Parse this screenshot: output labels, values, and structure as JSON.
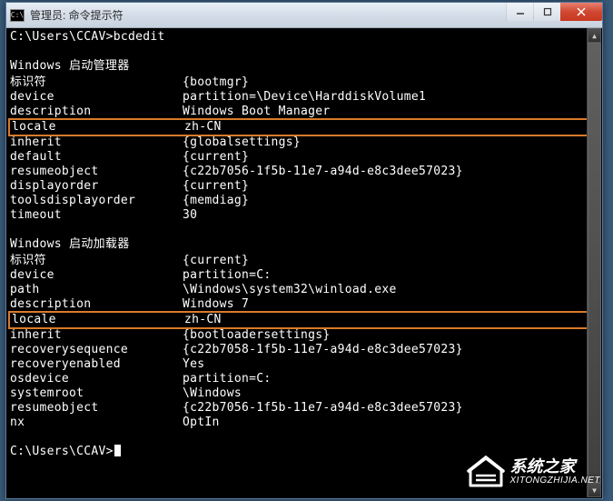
{
  "titlebar": {
    "icon_label": "C:\\",
    "text": "管理员: 命令提示符"
  },
  "controls": {
    "minimize": "—",
    "maximize": "□",
    "close": "×"
  },
  "terminal": {
    "prompt1": "C:\\Users\\CCAV>bcdedit",
    "section1_title": "Windows 启动管理器",
    "section1_divider": "--------------------",
    "section1_rows": [
      {
        "k": "标识符",
        "v": "{bootmgr}"
      },
      {
        "k": "device",
        "v": "partition=\\Device\\HarddiskVolume1"
      },
      {
        "k": "description",
        "v": "Windows Boot Manager"
      }
    ],
    "section1_highlight": {
      "k": "locale",
      "v": "zh-CN"
    },
    "section1_rows2": [
      {
        "k": "inherit",
        "v": "{globalsettings}"
      },
      {
        "k": "default",
        "v": "{current}"
      },
      {
        "k": "resumeobject",
        "v": "{c22b7056-1f5b-11e7-a94d-e8c3dee57023}"
      },
      {
        "k": "displayorder",
        "v": "{current}"
      },
      {
        "k": "toolsdisplayorder",
        "v": "{memdiag}"
      },
      {
        "k": "timeout",
        "v": "30"
      }
    ],
    "section2_title": "Windows 启动加载器",
    "section2_divider": "-------------------",
    "section2_rows": [
      {
        "k": "标识符",
        "v": "{current}"
      },
      {
        "k": "device",
        "v": "partition=C:"
      },
      {
        "k": "path",
        "v": "\\Windows\\system32\\winload.exe"
      },
      {
        "k": "description",
        "v": "Windows 7"
      }
    ],
    "section2_highlight": {
      "k": "locale",
      "v": "zh-CN"
    },
    "section2_rows2": [
      {
        "k": "inherit",
        "v": "{bootloadersettings}"
      },
      {
        "k": "recoverysequence",
        "v": "{c22b7058-1f5b-11e7-a94d-e8c3dee57023}"
      },
      {
        "k": "recoveryenabled",
        "v": "Yes"
      },
      {
        "k": "osdevice",
        "v": "partition=C:"
      },
      {
        "k": "systemroot",
        "v": "\\Windows"
      },
      {
        "k": "resumeobject",
        "v": "{c22b7056-1f5b-11e7-a94d-e8c3dee57023}"
      },
      {
        "k": "nx",
        "v": "OptIn"
      }
    ],
    "prompt2": "C:\\Users\\CCAV>"
  },
  "watermark": {
    "title": "系统之家",
    "url": "XITONGZHIJIA.NET"
  }
}
